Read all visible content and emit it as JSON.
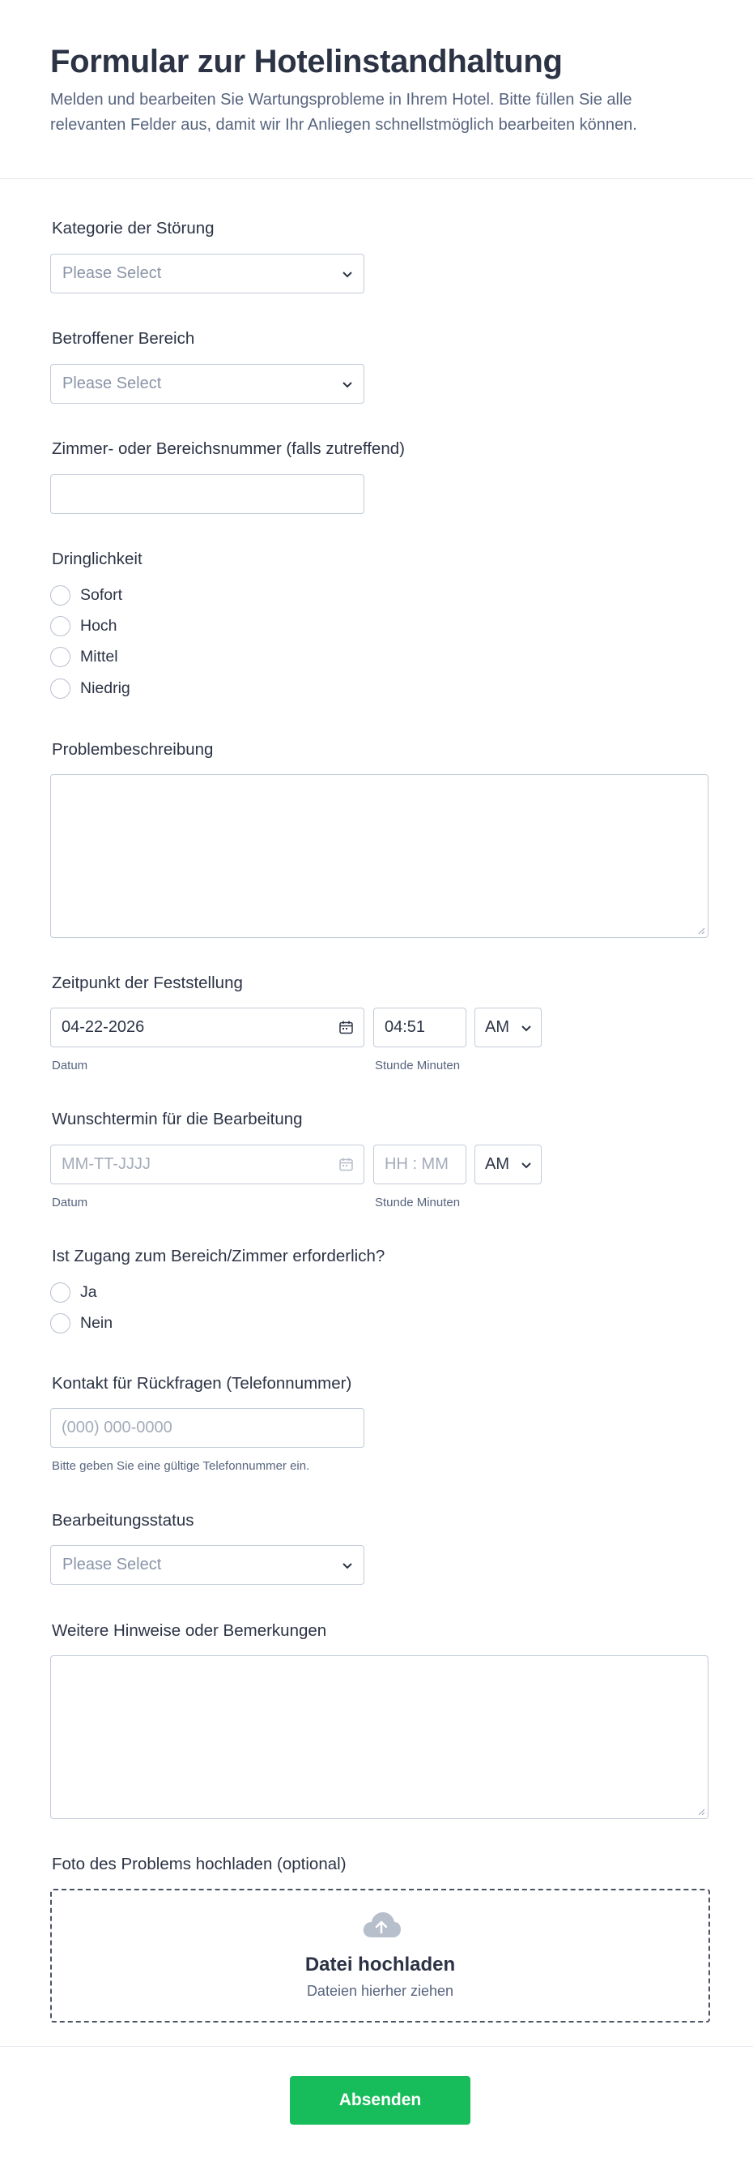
{
  "header": {
    "title": "Formular zur Hotelinstandhaltung",
    "subtitle": "Melden und bearbeiten Sie Wartungsprobleme in Ihrem Hotel. Bitte füllen Sie alle relevanten Felder aus, damit wir Ihr Anliegen schnellstmöglich bearbeiten können."
  },
  "category": {
    "label": "Kategorie der Störung",
    "value": "Please Select"
  },
  "area": {
    "label": "Betroffener Bereich",
    "value": "Please Select"
  },
  "room": {
    "label": "Zimmer- oder Bereichsnummer (falls zutreffend)",
    "value": ""
  },
  "urgency": {
    "label": "Dringlichkeit",
    "options": [
      "Sofort",
      "Hoch",
      "Mittel",
      "Niedrig"
    ]
  },
  "description": {
    "label": "Problembeschreibung"
  },
  "detected": {
    "label": "Zeitpunkt der Feststellung",
    "date": "04-22-2026",
    "time": "04:51",
    "ampm": "AM",
    "date_sublabel": "Datum",
    "time_sublabel": "Stunde Minuten"
  },
  "preferred": {
    "label": "Wunschtermin für die Bearbeitung",
    "date_placeholder": "MM-TT-JJJJ",
    "time_placeholder": "HH : MM",
    "ampm": "AM",
    "date_sublabel": "Datum",
    "time_sublabel": "Stunde Minuten"
  },
  "access": {
    "label": "Ist Zugang zum Bereich/Zimmer erforderlich?",
    "options": [
      "Ja",
      "Nein"
    ]
  },
  "contact": {
    "label": "Kontakt für Rückfragen (Telefonnummer)",
    "placeholder": "(000) 000-0000",
    "hint": "Bitte geben Sie eine gültige Telefonnummer ein."
  },
  "status": {
    "label": "Bearbeitungsstatus",
    "value": "Please Select"
  },
  "notes": {
    "label": "Weitere Hinweise oder Bemerkungen"
  },
  "upload": {
    "label": "Foto des Problems hochladen (optional)",
    "title": "Datei hochladen",
    "subtitle": "Dateien hierher ziehen",
    "icon": "cloud-upload-icon"
  },
  "submit": {
    "label": "Absenden",
    "color": "#18bd5b"
  }
}
